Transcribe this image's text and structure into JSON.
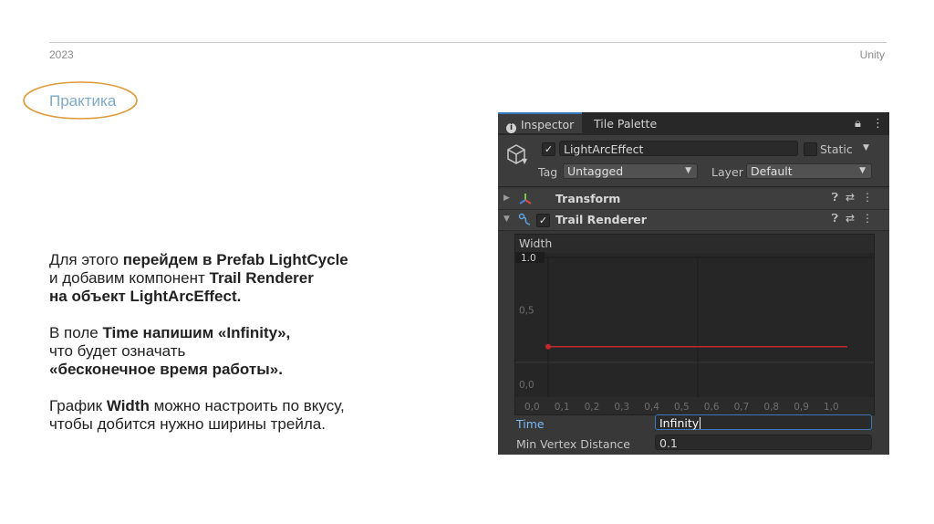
{
  "header": {
    "year": "2023",
    "brand": "Unity"
  },
  "section": {
    "title": "Практика"
  },
  "text": {
    "p1": [
      {
        "t": "Для этого ",
        "b": false
      },
      {
        "t": "перейдем в Prefab LightCycle",
        "b": true
      },
      {
        "br": true
      },
      {
        "t": "и добавим компонент ",
        "b": false
      },
      {
        "t": "Trail Renderer",
        "b": true
      },
      {
        "br": true
      },
      {
        "t": "на объект LightArcEffect.",
        "b": true
      }
    ],
    "p2": [
      {
        "t": "В поле ",
        "b": false
      },
      {
        "t": "Time напишим «Infinity»,",
        "b": true
      },
      {
        "br": true
      },
      {
        "t": "что будет означать",
        "b": false
      },
      {
        "br": true
      },
      {
        "t": "«бесконечное время работы».",
        "b": true
      }
    ],
    "p3": [
      {
        "t": "График ",
        "b": false
      },
      {
        "t": "Width",
        "b": true
      },
      {
        "t": " можно настроить по вкусу,",
        "b": false
      },
      {
        "br": true
      },
      {
        "t": "чтобы добится нужно ширины трейла.",
        "b": false
      }
    ]
  },
  "inspector": {
    "tabs": {
      "inspector": "Inspector",
      "tile_palette": "Tile Palette"
    },
    "object_name": "LightArcEffect",
    "static_label": "Static",
    "tag_label": "Tag",
    "tag_value": "Untagged",
    "layer_label": "Layer",
    "layer_value": "Default",
    "components": {
      "transform": "Transform",
      "trail_renderer": "Trail Renderer"
    },
    "icons": {
      "tab": "info-icon",
      "lock": "lock-icon",
      "menu": "more-icon",
      "cube": "gameobject-cube-icon",
      "help": "help-icon",
      "presets": "presets-icon"
    },
    "accent": "#3a79bb",
    "curve_color": "#c0282d"
  },
  "curve": {
    "label": "Width",
    "max_label": "1.0",
    "y_tick_labels": [
      "0,5",
      "0,0"
    ],
    "x_tick_labels": [
      "0,0",
      "0,1",
      "0,2",
      "0,3",
      "0,4",
      "0,5",
      "0,6",
      "0,7",
      "0,8",
      "0,9",
      "1,0"
    ]
  },
  "chart_data": {
    "type": "line",
    "title": "Width",
    "xlabel": "",
    "ylabel": "",
    "xlim": [
      0,
      1
    ],
    "ylim": [
      0,
      1
    ],
    "series": [
      {
        "x": [
          0.0,
          1.0
        ],
        "y": [
          0.15,
          0.15
        ]
      }
    ]
  },
  "fields": {
    "time_label": "Time",
    "time_value": "Infinity",
    "min_vertex_label": "Min Vertex Distance",
    "min_vertex_value": "0.1"
  }
}
